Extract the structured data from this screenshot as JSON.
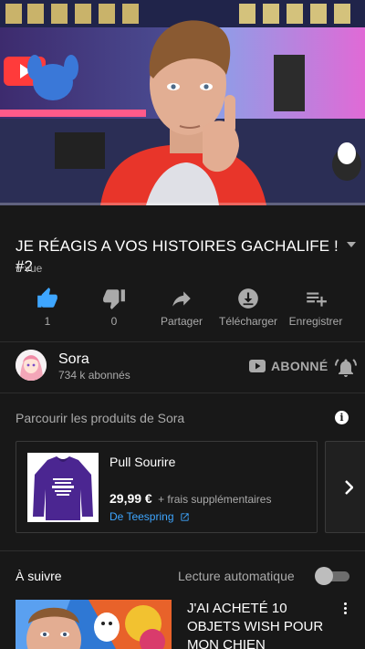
{
  "video": {
    "title": "JE RÉAGIS A VOS HISTOIRES GACHALIFE ! #2",
    "views": "1 vue",
    "progress_fraction": 0.0
  },
  "actions": [
    {
      "icon": "thumbs-up-icon",
      "label": "1"
    },
    {
      "icon": "thumbs-down-icon",
      "label": "0"
    },
    {
      "icon": "share-icon",
      "label": "Partager"
    },
    {
      "icon": "download-icon",
      "label": "Télécharger"
    },
    {
      "icon": "playlist-add-icon",
      "label": "Enregistrer"
    }
  ],
  "channel": {
    "name": "Sora",
    "subscribers": "734 k abonnés",
    "subscribe_label": "ABONNÉ",
    "bell_icon": "notification-bell-icon"
  },
  "merch": {
    "shelf_title": "Parcourir les produits de Sora",
    "info_icon": "i",
    "product": {
      "name": "Pull Sourire",
      "price": "29,99 €",
      "extra": "+ frais supplémentaires",
      "seller": "De Teespring"
    }
  },
  "up_next": {
    "label": "À suivre",
    "autoplay_label": "Lecture automatique",
    "autoplay_on": false,
    "video_title": "J'AI ACHETÉ 10 OBJETS WISH POUR MON CHIEN"
  },
  "colors": {
    "background": "#181818",
    "accent_like": "#3ea6ff",
    "link": "#3ea6ff",
    "progress": "#ff0000",
    "secondary_text": "#aaaaaa"
  }
}
